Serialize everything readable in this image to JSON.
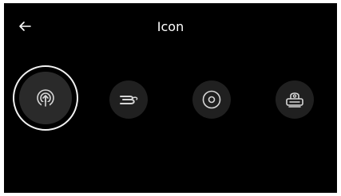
{
  "header": {
    "title": "Icon",
    "back_icon": "arrow-left-icon"
  },
  "icon_options": [
    {
      "icon": "antenna-signal-icon",
      "selected": true
    },
    {
      "icon": "blu-ray-icon",
      "selected": false
    },
    {
      "icon": "disc-icon",
      "selected": false
    },
    {
      "icon": "set-top-box-icon",
      "selected": false
    }
  ],
  "colors": {
    "background": "#000000",
    "tile": "#202020",
    "selected_ring": "#f2f2f2",
    "text": "#ffffff",
    "icon_stroke": "#d6d6d6"
  }
}
